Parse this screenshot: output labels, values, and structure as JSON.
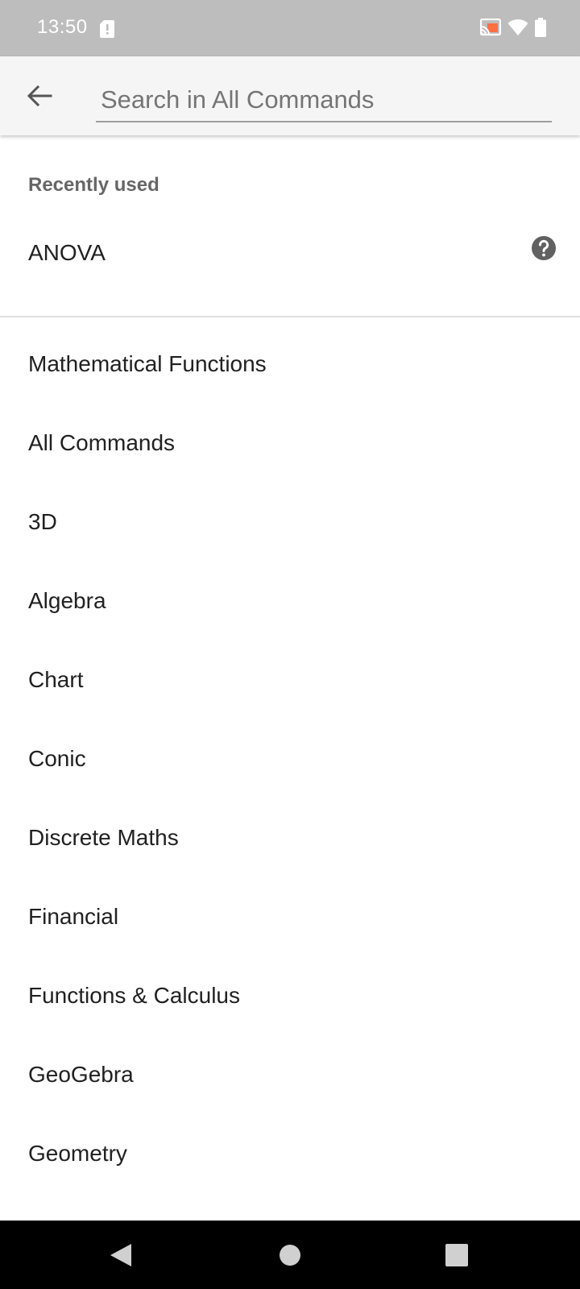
{
  "status_bar": {
    "time": "13:50",
    "icons": [
      "sd-card-alert-icon",
      "cast-icon",
      "wifi-icon",
      "battery-icon"
    ],
    "cast_accent": "#ff7043"
  },
  "search": {
    "placeholder": "Search in All Commands",
    "value": ""
  },
  "recent": {
    "header": "Recently used",
    "items": [
      {
        "label": "ANOVA",
        "icon": "help-icon"
      }
    ]
  },
  "categories": [
    {
      "label": "Mathematical Functions"
    },
    {
      "label": "All Commands"
    },
    {
      "label": "3D"
    },
    {
      "label": "Algebra"
    },
    {
      "label": "Chart"
    },
    {
      "label": "Conic"
    },
    {
      "label": "Discrete Maths"
    },
    {
      "label": "Financial"
    },
    {
      "label": "Functions & Calculus"
    },
    {
      "label": "GeoGebra"
    },
    {
      "label": "Geometry"
    }
  ],
  "nav": {
    "icons": [
      "nav-back-icon",
      "nav-home-icon",
      "nav-recents-icon"
    ]
  },
  "colors": {
    "status_bar": "#bdbdbd",
    "toolbar": "#f5f5f5",
    "section_header": "#666666",
    "text": "#212121",
    "divider": "#e0e0e0"
  }
}
